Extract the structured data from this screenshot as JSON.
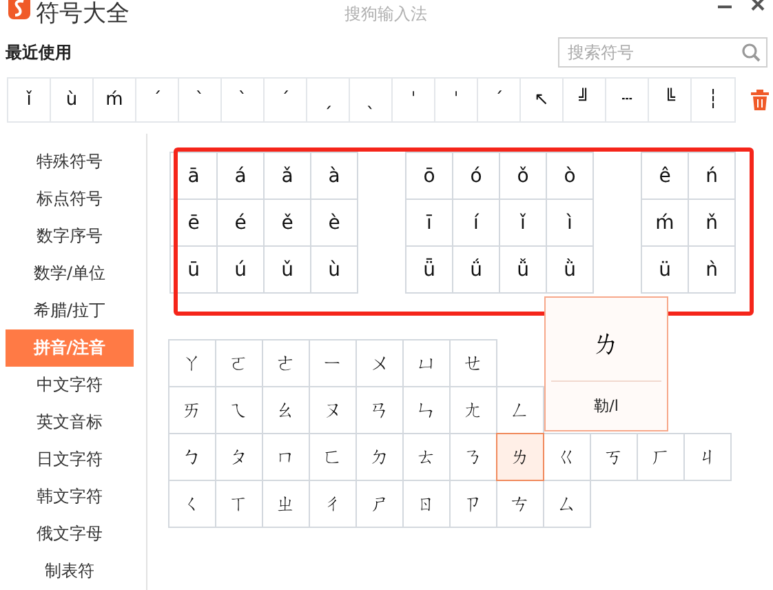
{
  "window": {
    "title": "符号大全",
    "app_name": "搜狗输入法"
  },
  "recent": {
    "label": "最近使用",
    "symbols": [
      "ǐ",
      "ù",
      "ḿ",
      "ˊ",
      "ˋ",
      "ˋ",
      "ˊ",
      "ˏ",
      "ˎ",
      "ˈ",
      "ˈ",
      "ˊ",
      "↖",
      "╝",
      "┄",
      "╚",
      "┆"
    ]
  },
  "search": {
    "placeholder": "搜索符号"
  },
  "sidebar": {
    "items": [
      {
        "label": "特殊符号",
        "selected": false
      },
      {
        "label": "标点符号",
        "selected": false
      },
      {
        "label": "数字序号",
        "selected": false
      },
      {
        "label": "数学/单位",
        "selected": false
      },
      {
        "label": "希腊/拉丁",
        "selected": false
      },
      {
        "label": "拼音/注音",
        "selected": true
      },
      {
        "label": "中文字符",
        "selected": false
      },
      {
        "label": "英文音标",
        "selected": false
      },
      {
        "label": "日文字符",
        "selected": false
      },
      {
        "label": "韩文字符",
        "selected": false
      },
      {
        "label": "俄文字母",
        "selected": false
      },
      {
        "label": "制表符",
        "selected": false
      }
    ]
  },
  "pinyin_groups": [
    [
      [
        "ā",
        "á",
        "ǎ",
        "à"
      ],
      [
        "ē",
        "é",
        "ě",
        "è"
      ],
      [
        "ū",
        "ú",
        "ǔ",
        "ù"
      ]
    ],
    [
      [
        "ō",
        "ó",
        "ǒ",
        "ò"
      ],
      [
        "ī",
        "í",
        "ǐ",
        "ì"
      ],
      [
        "ǖ",
        "ǘ",
        "ǚ",
        "ǜ"
      ]
    ],
    [
      [
        "ê",
        "ń"
      ],
      [
        "ḿ",
        "ň"
      ],
      [
        "ü",
        "ǹ"
      ]
    ]
  ],
  "zhuyin_rows": [
    [
      {
        "symbol": "ㄚ",
        "selected": false
      },
      {
        "symbol": "ㄛ",
        "selected": false
      },
      {
        "symbol": "ㄜ",
        "selected": false
      },
      {
        "symbol": "ㄧ",
        "selected": false
      },
      {
        "symbol": "ㄨ",
        "selected": false
      },
      {
        "symbol": "ㄩ",
        "selected": false
      },
      {
        "symbol": "ㄝ",
        "selected": false
      }
    ],
    [
      {
        "symbol": "ㄞ",
        "selected": false
      },
      {
        "symbol": "ㄟ",
        "selected": false
      },
      {
        "symbol": "ㄠ",
        "selected": false
      },
      {
        "symbol": "ㄡ",
        "selected": false
      },
      {
        "symbol": "ㄢ",
        "selected": false
      },
      {
        "symbol": "ㄣ",
        "selected": false
      },
      {
        "symbol": "ㄤ",
        "selected": false
      },
      {
        "symbol": "ㄥ",
        "selected": false
      }
    ],
    [
      {
        "symbol": "ㄅ",
        "selected": false
      },
      {
        "symbol": "ㄆ",
        "selected": false
      },
      {
        "symbol": "ㄇ",
        "selected": false
      },
      {
        "symbol": "ㄈ",
        "selected": false
      },
      {
        "symbol": "ㄉ",
        "selected": false
      },
      {
        "symbol": "ㄊ",
        "selected": false
      },
      {
        "symbol": "ㄋ",
        "selected": false
      },
      {
        "symbol": "ㄌ",
        "selected": true
      },
      {
        "symbol": "ㄍ",
        "selected": false
      },
      {
        "symbol": "ㄎ",
        "selected": false
      },
      {
        "symbol": "ㄏ",
        "selected": false
      },
      {
        "symbol": "ㄐ",
        "selected": false
      }
    ],
    [
      {
        "symbol": "ㄑ",
        "selected": false
      },
      {
        "symbol": "ㄒ",
        "selected": false
      },
      {
        "symbol": "ㄓ",
        "selected": false
      },
      {
        "symbol": "ㄔ",
        "selected": false
      },
      {
        "symbol": "ㄕ",
        "selected": false
      },
      {
        "symbol": "ㄖ",
        "selected": false
      },
      {
        "symbol": "ㄗ",
        "selected": false
      },
      {
        "symbol": "ㄘ",
        "selected": false
      },
      {
        "symbol": "ㄙ",
        "selected": false
      }
    ]
  ],
  "preview": {
    "symbol": "ㄌ",
    "reading": "勒/l"
  }
}
